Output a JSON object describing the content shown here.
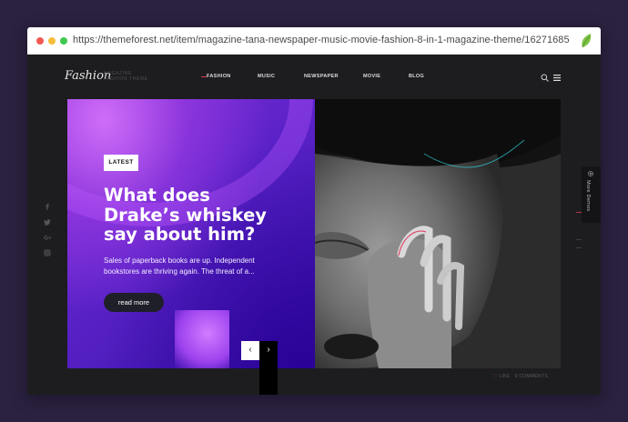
{
  "browser": {
    "url": "https://themeforest.net/item/magazine-tana-newspaper-music-movie-fashion-8-in-1-magazine-theme/16271685"
  },
  "site": {
    "logo": "Fashion",
    "logo_tagline": [
      "MAGAZINE",
      "FASHION THEME"
    ],
    "nav": [
      {
        "label": "FASHION",
        "active": true
      },
      {
        "label": "MUSIC",
        "active": false
      },
      {
        "label": "NEWSPAPER",
        "active": false
      },
      {
        "label": "MOVIE",
        "active": false
      },
      {
        "label": "BLOG",
        "active": false
      }
    ],
    "social_icons": [
      "facebook-icon",
      "twitter-icon",
      "google-plus-icon",
      "instagram-icon"
    ]
  },
  "hero": {
    "badge": "LATEST",
    "title": "What does Drake’s whiskey say about him?",
    "excerpt": "Sales of paperback books are up. Independent bookstores are thriving again. The threat of a...",
    "read_more": "read more",
    "prev": "‹",
    "next": "›"
  },
  "side_tab": {
    "label": "More Demos"
  },
  "post_meta": {
    "likes": "LIKE",
    "comments": "0 COMMENTS"
  },
  "colors": {
    "accent": "#e03a4e",
    "background": "#2b2140",
    "site_bg": "#1d1d1f"
  }
}
